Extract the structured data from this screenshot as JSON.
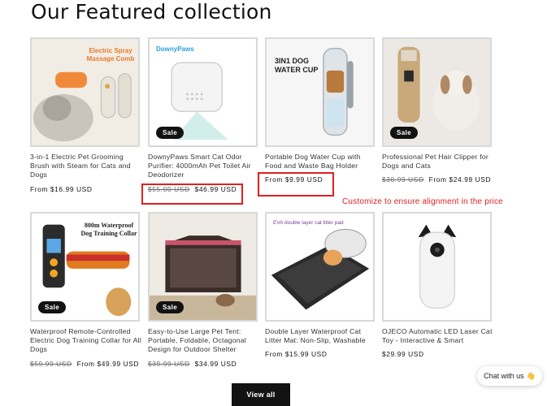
{
  "section": {
    "heading": "Our Featured collection"
  },
  "products": [
    {
      "title": "3-in-1 Electric Pet Grooming Brush with Steam for Cats and Dogs",
      "price": "From $16.99 USD",
      "sale": false,
      "image_label": "Electric Spray Massage Comb"
    },
    {
      "title": "DownyPaws Smart Cat Odor Purifier: 4000mAh Pet Toilet Air Deodorizer",
      "compare_price": "$55.00 USD",
      "price": "$46.99 USD",
      "sale": true,
      "badge": "Sale",
      "image_label": "DownyPaws"
    },
    {
      "title": "Portable Dog Water Cup with Food and Waste Bag Holder",
      "price": "From $9.99 USD",
      "sale": false,
      "image_label": "3IN1 DOG WATER CUP"
    },
    {
      "title": "Professional Pet Hair Clipper for Dogs and Cats",
      "compare_price": "$30.99 USD",
      "price": "From $24.99 USD",
      "sale": true,
      "badge": "Sale"
    },
    {
      "title": "Waterproof Remote-Controlled Electric Dog Training Collar for All Dogs",
      "compare_price": "$59.99 USD",
      "price": "From $49.99 USD",
      "sale": true,
      "badge": "Sale",
      "image_label": "800m Waterproof Dog Training Collar"
    },
    {
      "title": "Easy-to-Use Large Pet Tent: Portable, Foldable, Octagonal Design for Outdoor Shelter",
      "compare_price": "$39.99 USD",
      "price": "$34.99 USD",
      "sale": true,
      "badge": "Sale"
    },
    {
      "title": "Double Layer Waterproof Cat Litter Mat: Non-Slip, Washable",
      "price": "From $15.99 USD",
      "sale": false,
      "image_label": "EVA double layer cat litter pad"
    },
    {
      "title": "OJECO Automatic LED Laser Cat Toy - Interactive & Smart",
      "price": "$29.99 USD",
      "sale": false
    }
  ],
  "annotation": {
    "text": "Customize to ensure alignment in the price"
  },
  "view_all": {
    "label": "View all"
  },
  "chat": {
    "label": "Chat with us",
    "emoji": "👋"
  },
  "colors": {
    "annotation_red": "#e02020",
    "button_bg": "#121212",
    "badge_bg": "#121212"
  }
}
